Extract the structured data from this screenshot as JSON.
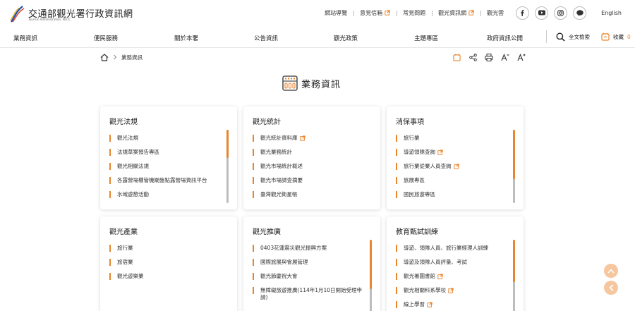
{
  "header": {
    "logo_text": "交通部觀光署行政資訊網",
    "logo_sub": "Tourism Administration, MOTC",
    "top_links": [
      {
        "label": "網站導覽",
        "external": false
      },
      {
        "label": "意見信箱",
        "external": true
      },
      {
        "label": "常見問題",
        "external": false
      },
      {
        "label": "觀光資訊網",
        "external": true
      },
      {
        "label": "觀光雲",
        "external": false
      }
    ],
    "language": "English"
  },
  "nav": {
    "items": [
      "業務資訊",
      "便民服務",
      "關於本署",
      "公告資訊",
      "觀光政策",
      "主題專區",
      "政府資訊公開"
    ],
    "search_label": "全文檢索",
    "favorites_label": "收藏",
    "favorites_count": "0"
  },
  "breadcrumb": {
    "current": "業務資訊"
  },
  "page": {
    "title": "業務資訊"
  },
  "cards": [
    {
      "title": "觀光法規",
      "items": [
        {
          "label": "觀光法規",
          "external": false
        },
        {
          "label": "法規草案預告專區",
          "external": false
        },
        {
          "label": "觀光相關法規",
          "external": false
        },
        {
          "label": "各露營場權管機關盤點露營場資訊平台",
          "external": false
        },
        {
          "label": "水域遊憩活動",
          "external": false
        }
      ],
      "scroll": true
    },
    {
      "title": "觀光統計",
      "items": [
        {
          "label": "觀光統計資料庫",
          "external": true
        },
        {
          "label": "觀光業務統計",
          "external": false
        },
        {
          "label": "觀光市場統計概述",
          "external": false
        },
        {
          "label": "觀光市場調查摘要",
          "external": false
        },
        {
          "label": "臺灣觀光衛星帳",
          "external": false
        }
      ],
      "scroll": false
    },
    {
      "title": "消保事項",
      "items": [
        {
          "label": "旅行業",
          "external": false
        },
        {
          "label": "導遊領隊查詢",
          "external": true
        },
        {
          "label": "旅行業從業人員查詢",
          "external": true
        },
        {
          "label": "旅展專區",
          "external": false
        },
        {
          "label": "國民旅遊專區",
          "external": false
        }
      ],
      "scroll": true
    },
    {
      "title": "觀光產業",
      "items": [
        {
          "label": "旅行業",
          "external": false
        },
        {
          "label": "旅宿業",
          "external": false
        },
        {
          "label": "觀光遊樂業",
          "external": false
        }
      ],
      "scroll": false
    },
    {
      "title": "觀光推廣",
      "items": [
        {
          "label": "0403花蓮震災觀光振興方案",
          "external": false
        },
        {
          "label": "國際旅展與會展管理",
          "external": false
        },
        {
          "label": "觀光節慶祝大會",
          "external": false
        },
        {
          "label": "無障礙旅遊推廣(114年1月10日開始受理申請)",
          "external": false
        }
      ],
      "scroll": true
    },
    {
      "title": "教育甄試訓練",
      "items": [
        {
          "label": "導遊、領隊人員、旅行業經理人訓練",
          "external": false
        },
        {
          "label": "導遊及領隊人員評量、考試",
          "external": false
        },
        {
          "label": "觀光署圖書館",
          "external": true
        },
        {
          "label": "觀光相關科系學校",
          "external": true
        },
        {
          "label": "線上學習",
          "external": true
        }
      ],
      "scroll": true
    }
  ],
  "colors": {
    "accent": "#e8862e",
    "fab": "#f6c79f"
  }
}
